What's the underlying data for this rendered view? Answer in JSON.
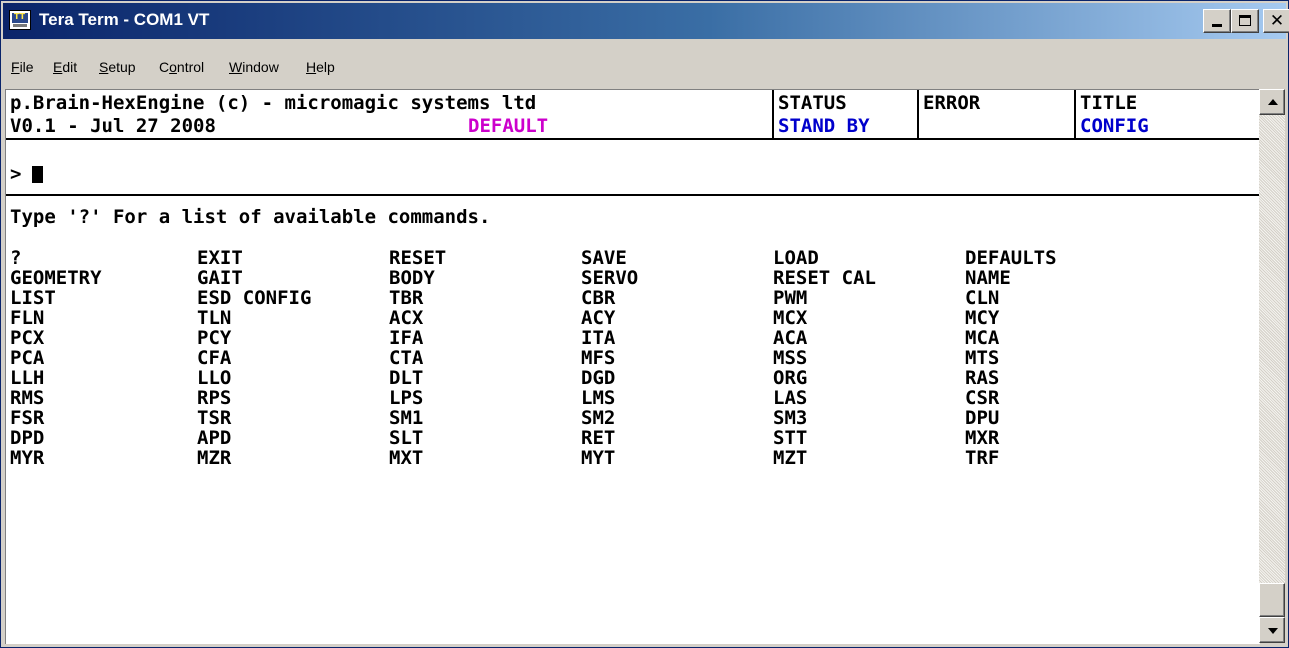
{
  "window": {
    "title": "Tera Term - COM1 VT",
    "icon": "teraterm-app-icon",
    "controls": {
      "minimize": "minimize-icon",
      "maximize": "maximize-icon",
      "close_glyph": "✕"
    }
  },
  "menubar": {
    "items": [
      {
        "key": "file",
        "pre": "",
        "u": "F",
        "post": "ile"
      },
      {
        "key": "edit",
        "pre": "",
        "u": "E",
        "post": "dit"
      },
      {
        "key": "setup",
        "pre": "",
        "u": "S",
        "post": "etup"
      },
      {
        "key": "control",
        "pre": "C",
        "u": "o",
        "post": "ntrol"
      },
      {
        "key": "window",
        "pre": "",
        "u": "W",
        "post": "indow"
      },
      {
        "key": "help",
        "pre": "",
        "u": "H",
        "post": "elp"
      }
    ]
  },
  "terminal": {
    "header": {
      "app_line": "p.Brain-HexEngine (c) - micromagic systems ltd",
      "version_line": "V0.1 - Jul 27 2008",
      "profile": "DEFAULT",
      "status_label": "STATUS",
      "status_value": "STAND BY",
      "error_label": "ERROR",
      "error_value": "",
      "title_label": "TITLE",
      "title_value": "CONFIG"
    },
    "prompt": ">",
    "help_text": "Type '?' For a list of available commands.",
    "commands": [
      [
        "?",
        "EXIT",
        "RESET",
        "SAVE",
        "LOAD",
        "DEFAULTS"
      ],
      [
        "GEOMETRY",
        "GAIT",
        "BODY",
        "SERVO",
        "RESET CAL",
        "NAME"
      ],
      [
        "LIST",
        "ESD CONFIG",
        "TBR",
        "CBR",
        "PWM",
        "CLN"
      ],
      [
        "FLN",
        "TLN",
        "ACX",
        "ACY",
        "MCX",
        "MCY"
      ],
      [
        "PCX",
        "PCY",
        "IFA",
        "ITA",
        "ACA",
        "MCA"
      ],
      [
        "PCA",
        "CFA",
        "CTA",
        "MFS",
        "MSS",
        "MTS"
      ],
      [
        "LLH",
        "LLO",
        "DLT",
        "DGD",
        "ORG",
        "RAS"
      ],
      [
        "RMS",
        "RPS",
        "LPS",
        "LMS",
        "LAS",
        "CSR"
      ],
      [
        "FSR",
        "TSR",
        "SM1",
        "SM2",
        "SM3",
        "DPU"
      ],
      [
        "DPD",
        "APD",
        "SLT",
        "RET",
        "STT",
        "MXR"
      ],
      [
        "MYR",
        "MZR",
        "MXT",
        "MYT",
        "MZT",
        "TRF"
      ]
    ]
  },
  "colors": {
    "title_gradient_start": "#0a246a",
    "title_gradient_end": "#a6caf0",
    "profile_color": "#cc00cc",
    "status_value_color": "#0000cc"
  }
}
